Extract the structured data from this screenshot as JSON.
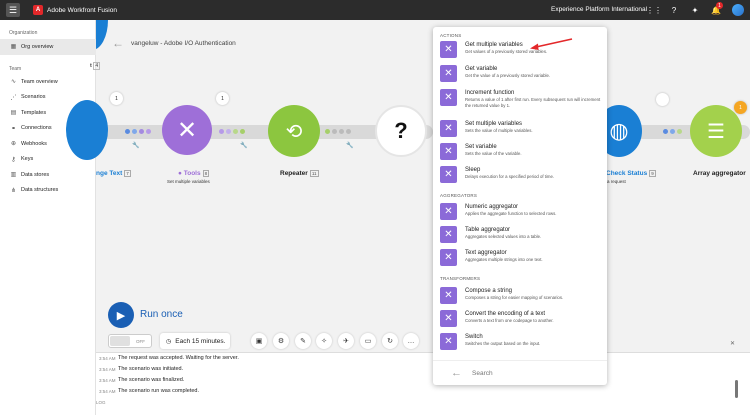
{
  "topbar": {
    "app_title": "Adobe Workfront Fusion",
    "org_name": "Experience Platform International",
    "notification_count": "1"
  },
  "sidebar": {
    "org_section": "Organization",
    "org_item": "Org overview",
    "team_section": "Team",
    "items": [
      {
        "label": "Team overview",
        "icon": "team-overview-icon"
      },
      {
        "label": "Scenarios",
        "icon": "scenarios-icon"
      },
      {
        "label": "Templates",
        "icon": "templates-icon"
      },
      {
        "label": "Connections",
        "icon": "connections-icon"
      },
      {
        "label": "Webhooks",
        "icon": "webhooks-icon"
      },
      {
        "label": "Keys",
        "icon": "keys-icon"
      },
      {
        "label": "Data stores",
        "icon": "data-stores-icon"
      },
      {
        "label": "Data structures",
        "icon": "data-structures-icon"
      }
    ]
  },
  "scenario": {
    "breadcrumb": "vangeluw - Adobe I/O Authentication",
    "version_prefix": "t",
    "version": "4"
  },
  "nodes": {
    "text": {
      "label": "nge Text",
      "count": "7",
      "bubble": "1"
    },
    "tools": {
      "label": "Tools",
      "count": "8",
      "sub": "Set multiple variables",
      "bubble": "1"
    },
    "repeater": {
      "label": "Repeater",
      "count": "11"
    },
    "check_status": {
      "label": "Check Status",
      "count": "9",
      "sub": "a request"
    },
    "array_aggregator": {
      "label": "Array aggregator",
      "bubble": "1"
    }
  },
  "controls": {
    "run_once": "Run once",
    "toggle_off": "OFF",
    "schedule": "Each 15 minutes."
  },
  "log": {
    "rows": [
      {
        "time": "3:54 AM",
        "text": "The request was accepted. Waiting for the server."
      },
      {
        "time": "3:54 AM",
        "text": "The scenario was initiated."
      },
      {
        "time": "3:54 AM",
        "text": "The scenario was finalized."
      },
      {
        "time": "3:54 AM",
        "text": "The scenario run was completed."
      }
    ],
    "footer": "LOG"
  },
  "picker": {
    "groups": {
      "actions": "ACTIONS",
      "aggregators": "AGGREGATORS",
      "transformers": "TRANSFORMERS"
    },
    "actions": [
      {
        "name": "Get multiple variables",
        "desc": "Get values of a previously stored variables."
      },
      {
        "name": "Get variable",
        "desc": "Get the value of a previously stored variable."
      },
      {
        "name": "Increment function",
        "desc": "Returns a value of 1 after first run. Every subsequent run will increment the returned value by 1."
      },
      {
        "name": "Set multiple variables",
        "desc": "Sets the value of multiple variables."
      },
      {
        "name": "Set variable",
        "desc": "Sets the value of the variable."
      },
      {
        "name": "Sleep",
        "desc": "Delays execution for a specified period of time."
      }
    ],
    "aggregators": [
      {
        "name": "Numeric aggregator",
        "desc": "Applies the aggregate function to selected rows."
      },
      {
        "name": "Table aggregator",
        "desc": "Aggregates selected values into a table."
      },
      {
        "name": "Text aggregator",
        "desc": "Aggregates multiple strings into one text."
      }
    ],
    "transformers": [
      {
        "name": "Compose a string",
        "desc": "Composes a string for easier mapping of scenarios."
      },
      {
        "name": "Convert the encoding of a text",
        "desc": "Converts a text from one codepage to another."
      },
      {
        "name": "Switch",
        "desc": "Switches the output based on the input."
      }
    ],
    "search_placeholder": "Search"
  },
  "colors": {
    "tools_purple": "#9e6fd8",
    "repeater_green": "#8cc63f",
    "http_blue": "#1a7fd4",
    "aggregator_green": "#a3d14c",
    "run_blue": "#1a5fb4",
    "picker_icon": "#8b6ad8",
    "arrow_red": "#e3282a"
  }
}
